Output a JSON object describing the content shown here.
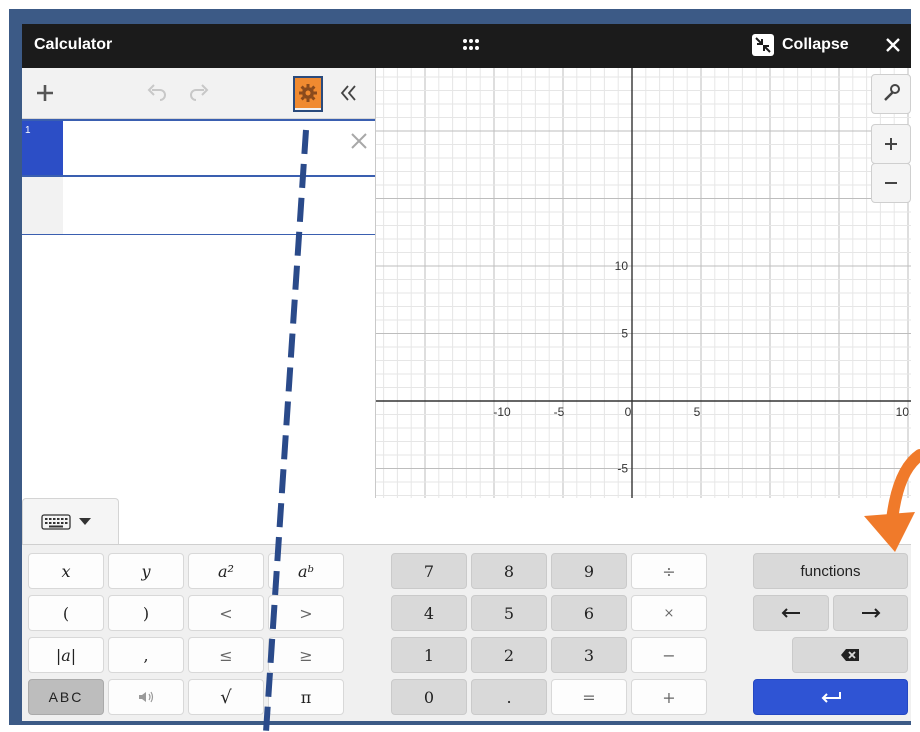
{
  "window": {
    "title": "Calculator",
    "collapse_label": "Collapse"
  },
  "expressions": [
    {
      "index": "1",
      "value": ""
    },
    {
      "index": "",
      "value": ""
    }
  ],
  "graph": {
    "x_ticks": [
      "-10",
      "-5",
      "0",
      "5",
      "10"
    ],
    "y_ticks": [
      "10",
      "5",
      "-5"
    ]
  },
  "keypad": {
    "left": [
      [
        "x",
        "y",
        "a²",
        "aᵇ"
      ],
      [
        "(",
        ")",
        "<",
        ">"
      ],
      [
        "|a|",
        ",",
        "≤",
        "≥"
      ],
      [
        "ABC",
        "speaker",
        "√",
        "π"
      ]
    ],
    "middle": [
      [
        "7",
        "8",
        "9",
        "÷"
      ],
      [
        "4",
        "5",
        "6",
        "×"
      ],
      [
        "1",
        "2",
        "3",
        "−"
      ],
      [
        "0",
        ".",
        "=",
        "+"
      ]
    ],
    "functions_label": "functions"
  },
  "colors": {
    "title_bar": "#1b1b1b",
    "active_expression": "#2c4ec6",
    "enter_key": "#2f54d4",
    "settings_highlight": "#f08a30",
    "annotation_line": "#2a4a8a",
    "annotation_arrow": "#f07a2a"
  }
}
